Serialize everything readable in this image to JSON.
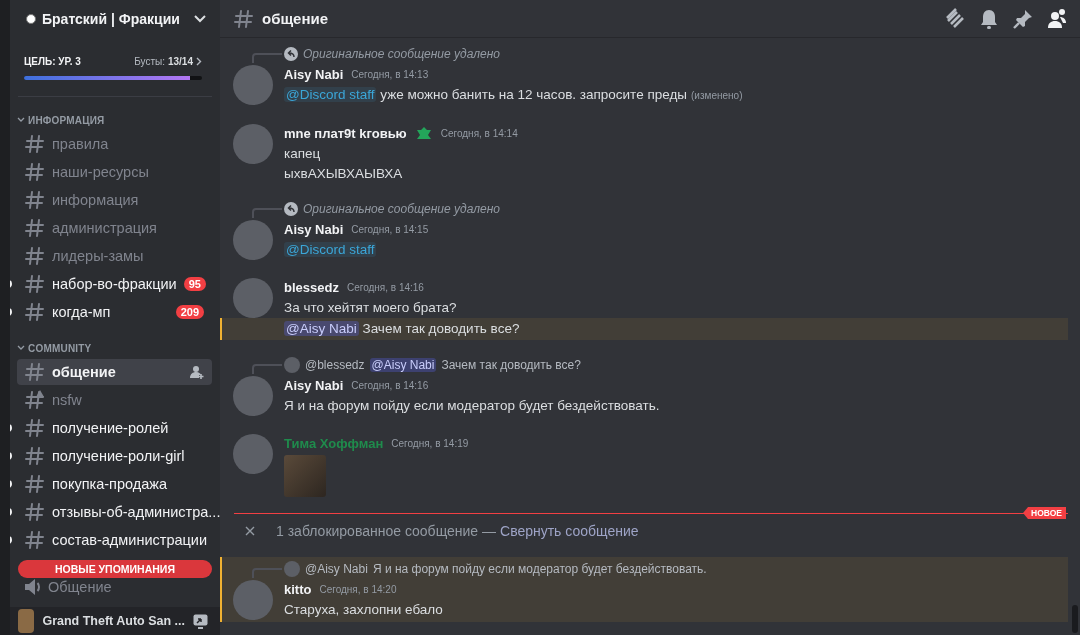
{
  "sidebar": {
    "server_name": "Братский | Фракции",
    "boost": {
      "goal": "ЦЕЛЬ: УР. 3",
      "label": "Бусты:",
      "value": "13/14",
      "level": 0.93
    },
    "categories": [
      {
        "name": "ИНФОРМАЦИЯ",
        "expanded": true,
        "channels": [
          {
            "name": "правила",
            "kind": "text",
            "unread": false,
            "selected": false
          },
          {
            "name": "наши-ресурсы",
            "kind": "text",
            "unread": false,
            "selected": false
          },
          {
            "name": "информация",
            "kind": "text",
            "unread": false,
            "selected": false
          },
          {
            "name": "администрация",
            "kind": "text",
            "unread": false,
            "selected": false
          },
          {
            "name": "лидеры-замы",
            "kind": "text",
            "unread": false,
            "selected": false
          },
          {
            "name": "набор-во-фракции",
            "kind": "text",
            "unread": true,
            "selected": false,
            "badge": "95"
          },
          {
            "name": "когда-мп",
            "kind": "text",
            "unread": true,
            "selected": false,
            "badge": "209"
          }
        ]
      },
      {
        "name": "COMMUNITY",
        "expanded": true,
        "channels": [
          {
            "name": "общение",
            "kind": "text",
            "unread": false,
            "selected": true
          },
          {
            "name": "nsfw",
            "kind": "nsfw",
            "unread": false,
            "selected": false
          },
          {
            "name": "получение-ролей",
            "kind": "text",
            "unread": true,
            "selected": false
          },
          {
            "name": "получение-роли-girl",
            "kind": "text",
            "unread": true,
            "selected": false
          },
          {
            "name": "покупка-продажа",
            "kind": "text",
            "unread": true,
            "selected": false
          },
          {
            "name": "отзывы-об-администра...",
            "kind": "text",
            "unread": true,
            "selected": false
          },
          {
            "name": "состав-администрации",
            "kind": "text",
            "unread": true,
            "selected": false
          },
          {
            "name": "Общение",
            "kind": "voice",
            "unread": false,
            "selected": false
          }
        ]
      }
    ],
    "new_mentions": "НОВЫЕ УПОМИНАНИЯ",
    "activity": "Grand Theft Auto San ..."
  },
  "channel": {
    "name": "общение"
  },
  "messages": [
    {
      "kind": "message",
      "mentioned": false,
      "reply": {
        "kind": "deleted",
        "text": "Оригинальное сообщение удалено"
      },
      "author": "Aisy Nabi",
      "color": "#f2f3f5",
      "badge": false,
      "time": "Сегодня, в 14:13",
      "content": {
        "kind": "text",
        "mention": {
          "kind": "role",
          "text": "@Discord staff"
        },
        "text": "уже можно банить на 12 часов. запросите преды",
        "edited": "(изменено)"
      }
    },
    {
      "kind": "message",
      "mentioned": false,
      "author": "mne плат9t kговью",
      "color": "#f2f3f5",
      "badge": true,
      "time": "Сегодня, в 14:14",
      "content": {
        "kind": "text",
        "text": "капец"
      }
    },
    {
      "kind": "continuation",
      "mentioned": false,
      "content": {
        "kind": "text",
        "text": "ыхвАХЫВХАЫВХА"
      }
    },
    {
      "kind": "message",
      "mentioned": false,
      "reply": {
        "kind": "deleted",
        "text": "Оригинальное сообщение удалено"
      },
      "author": "Aisy Nabi",
      "color": "#f2f3f5",
      "badge": false,
      "time": "Сегодня, в 14:15",
      "content": {
        "kind": "text",
        "mention": {
          "kind": "role",
          "text": "@Discord staff"
        }
      }
    },
    {
      "kind": "message",
      "mentioned": false,
      "author": "blessedz",
      "color": "#f2f3f5",
      "badge": false,
      "time": "Сегодня, в 14:16",
      "content": {
        "kind": "text",
        "text": "За что хейтят моего брата?"
      }
    },
    {
      "kind": "continuation",
      "mentioned": true,
      "content": {
        "kind": "text",
        "mention": {
          "kind": "user",
          "text": "@Aisy Nabi"
        },
        "text": "Зачем так доводить все?"
      }
    },
    {
      "kind": "message",
      "mentioned": false,
      "reply": {
        "kind": "message",
        "author": "@blessedz",
        "mention": "@Aisy Nabi",
        "text": "Зачем так доводить все?"
      },
      "author": "Aisy Nabi",
      "color": "#f2f3f5",
      "badge": false,
      "time": "Сегодня, в 14:16",
      "content": {
        "kind": "text",
        "text": "Я и на форум пойду если модератор будет бездействовать."
      }
    },
    {
      "kind": "message",
      "mentioned": false,
      "author": "Тима Хоффман",
      "color": "#1f8b4c",
      "badge": false,
      "time": "Сегодня, в 14:19",
      "content": {
        "kind": "image"
      }
    },
    {
      "kind": "new_divider",
      "label": "НОВОЕ"
    },
    {
      "kind": "blocked",
      "text": "1 заблокированное сообщение —",
      "link": "Свернуть сообщение"
    },
    {
      "kind": "message",
      "mentioned": true,
      "reply": {
        "kind": "message",
        "author": "@Aisy Nabi",
        "text": "Я и на форум пойду если модератор будет бездействовать."
      },
      "author": "kitto",
      "color": "#f2f3f5",
      "badge": false,
      "time": "Сегодня, в 14:20",
      "content": {
        "kind": "text",
        "text": "Старуха, захлопни ебало"
      }
    }
  ]
}
